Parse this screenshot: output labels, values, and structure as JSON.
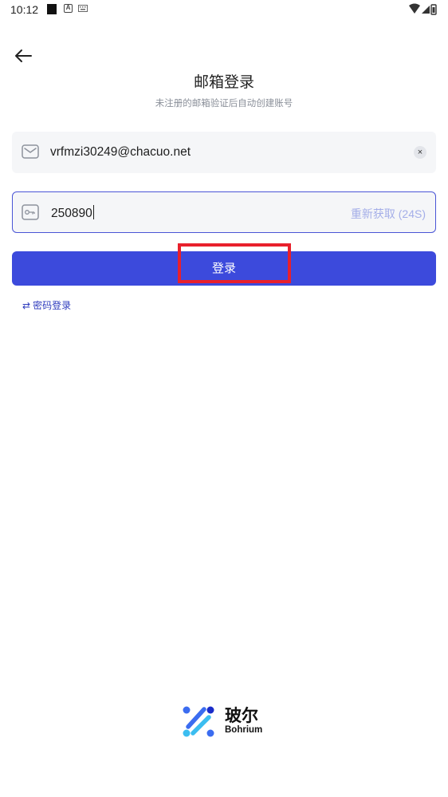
{
  "status_bar": {
    "time": "10:12",
    "icons": [
      "notification-square-icon",
      "a-icon",
      "keyboard-icon",
      "wifi-icon",
      "signal-icon",
      "battery-icon"
    ]
  },
  "header": {
    "title": "邮箱登录",
    "subtitle": "未注册的邮箱验证后自动创建账号"
  },
  "email": {
    "value": "vrfmzi30249@chacuo.net",
    "clear_icon": "×"
  },
  "code": {
    "value": "250890",
    "resend_label": "重新获取 (24S)"
  },
  "login_button": {
    "label": "登录"
  },
  "password_login": {
    "icon": "⇄",
    "label": "密码登录"
  },
  "brand": {
    "name_cn": "玻尔",
    "name_en": "Bohrium"
  },
  "colors": {
    "primary": "#3c4adc",
    "focus_border": "#4a55d6",
    "muted_text": "#8a8f99",
    "resend_text": "#a4aee8",
    "highlight": "#e8202c"
  }
}
